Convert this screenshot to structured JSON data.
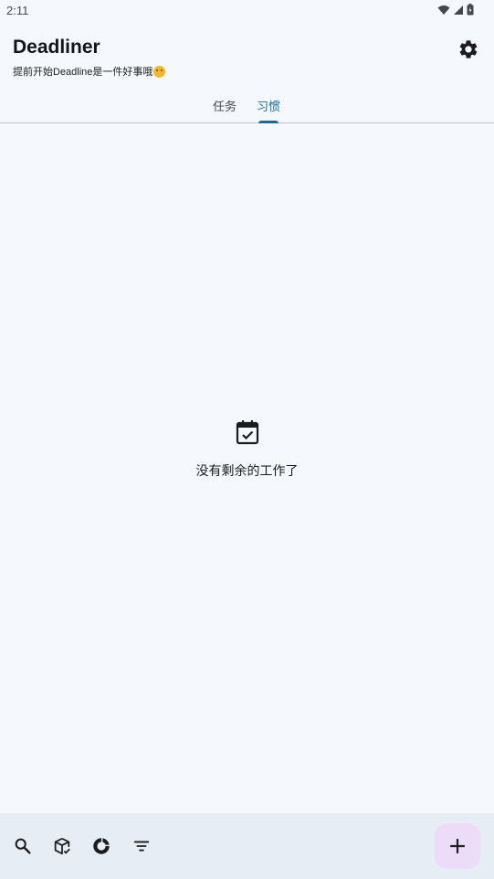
{
  "status_bar": {
    "time": "2:11"
  },
  "header": {
    "title": "Deadliner",
    "subtitle": "提前开始Deadline是一件好事哦"
  },
  "tabs": [
    {
      "label": "任务",
      "selected": false
    },
    {
      "label": "习惯",
      "selected": true
    }
  ],
  "empty_state": {
    "message": "没有剩余的工作了"
  },
  "bottom_bar": {
    "icons": [
      "search-icon",
      "archive-box-icon",
      "donut-chart-icon",
      "filter-icon"
    ],
    "fab_icon": "plus-icon"
  },
  "colors": {
    "background": "#f5f9fd",
    "accent": "#1a6b95",
    "bottom_bar": "#e7edf4",
    "fab": "#ecdcf8"
  }
}
